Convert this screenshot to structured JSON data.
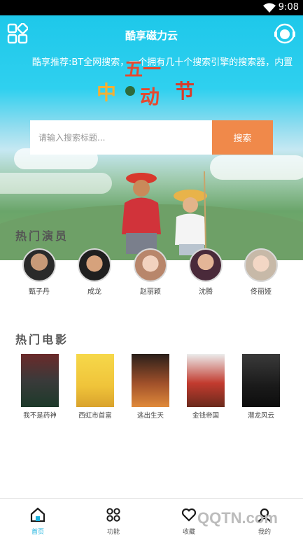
{
  "status_bar": {
    "time": "9:08"
  },
  "header": {
    "title": "酷享磁力云",
    "ticker": "酷享推荐:BT全网搜索，一个拥有几十个搜索引擎的搜索器，内置"
  },
  "banner": {
    "art_text": "五一 中动节"
  },
  "search": {
    "placeholder": "请输入搜索标题...",
    "button_label": "搜索"
  },
  "hot_actors": {
    "title": "热门演员",
    "items": [
      {
        "name": "甄子丹"
      },
      {
        "name": "成龙"
      },
      {
        "name": "赵丽颖"
      },
      {
        "name": "沈腾"
      },
      {
        "name": "佟丽娅"
      }
    ]
  },
  "hot_movies": {
    "title": "热门电影",
    "items": [
      {
        "title": "我不是药神"
      },
      {
        "title": "西虹市首富"
      },
      {
        "title": "逃出生天"
      },
      {
        "title": "金钱帝国"
      },
      {
        "title": "潜龙风云"
      }
    ]
  },
  "bottom_nav": {
    "items": [
      {
        "label": "首页",
        "icon": "home-icon"
      },
      {
        "label": "功能",
        "icon": "apps-icon"
      },
      {
        "label": "收藏",
        "icon": "favorite-icon"
      },
      {
        "label": "我的",
        "icon": "profile-icon"
      }
    ]
  },
  "watermark": "QQTN.com",
  "colors": {
    "accent": "#1bb2dd",
    "search_button": "#f0894a",
    "hero_sky": "#1ec8ea"
  }
}
